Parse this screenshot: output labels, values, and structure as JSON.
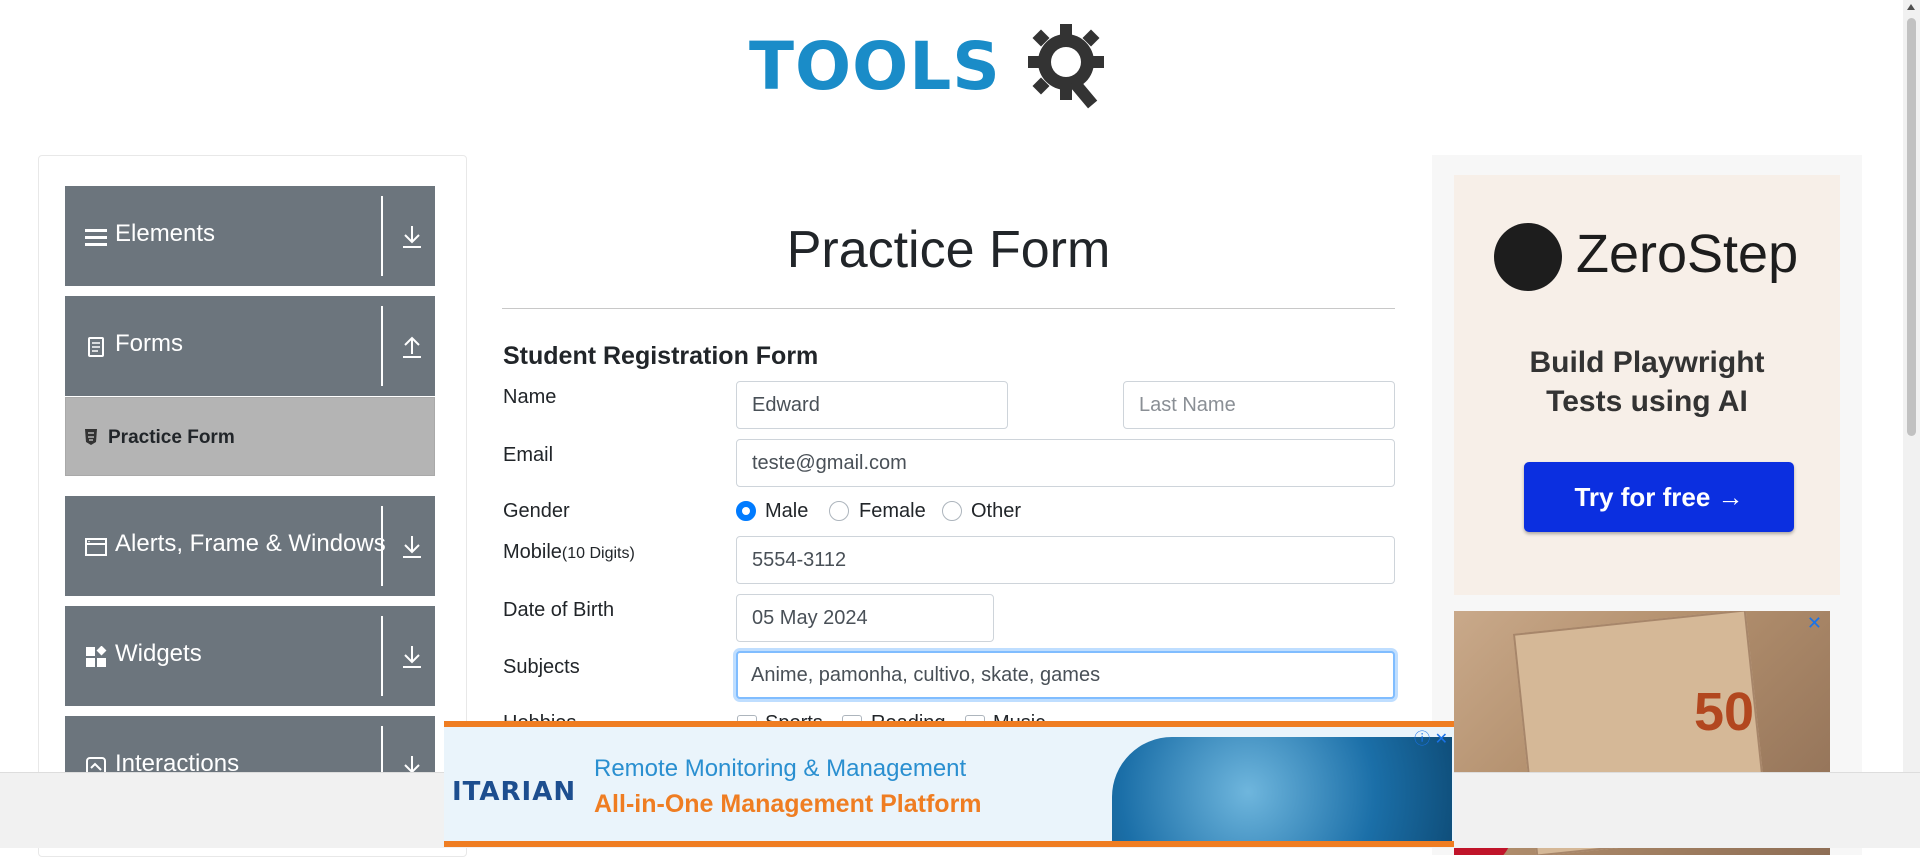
{
  "header": {
    "logo_text": "TOOLSQA"
  },
  "sidebar": {
    "groups": [
      {
        "label": "Elements",
        "icon": "hamburger-icon",
        "arrow": "download-arrow-icon"
      },
      {
        "label": "Forms",
        "icon": "document-icon",
        "arrow": "upload-arrow-icon"
      },
      {
        "label": "Alerts, Frame & Windows",
        "icon": "window-icon",
        "arrow": "download-arrow-icon"
      },
      {
        "label": "Widgets",
        "icon": "widgets-icon",
        "arrow": "download-arrow-icon"
      },
      {
        "label": "Interactions",
        "icon": "interactions-icon",
        "arrow": "download-arrow-icon"
      }
    ],
    "active_item": "Practice Form"
  },
  "main": {
    "title": "Practice Form",
    "subtitle": "Student Registration Form",
    "labels": {
      "name": "Name",
      "email": "Email",
      "gender": "Gender",
      "mobile": "Mobile",
      "mobile_hint": "(10 Digits)",
      "dob": "Date of Birth",
      "subjects": "Subjects",
      "hobbies": "Hobbies"
    },
    "first_name": "Edward",
    "last_name_placeholder": "Last Name",
    "email": "teste@gmail.com",
    "gender_options": [
      "Male",
      "Female",
      "Other"
    ],
    "gender_selected": "Male",
    "mobile": "5554-3112",
    "dob": "05 May 2024",
    "subjects": "Anime, pamonha, cultivo, skate, games",
    "hobby_options": [
      "Sports",
      "Reading",
      "Music"
    ]
  },
  "ad_right": {
    "brand": "ZeroStep",
    "tagline_1": "Build Playwright",
    "tagline_2": "Tests using AI",
    "cta": "Try for free →",
    "image_text": "50",
    "colors": {
      "cta": "#0b2fe0"
    }
  },
  "ad_bottom": {
    "brand": "ITARIAN",
    "line1": "Remote Monitoring & Management",
    "line2": "All-in-One Management Platform",
    "colors": {
      "accent": "#ef7d22",
      "text": "#2a8fd0"
    }
  },
  "colors": {
    "sidebar_group": "#6c757d",
    "logo_blue": "#1a8cc8",
    "radio_selected": "#007bff"
  }
}
